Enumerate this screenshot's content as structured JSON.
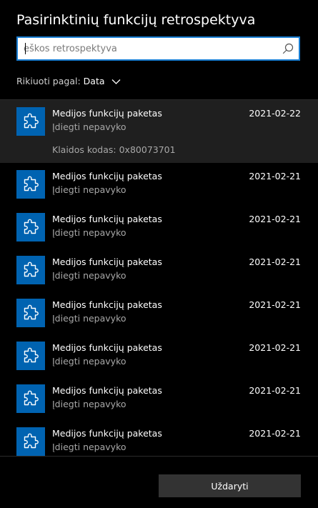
{
  "window": {
    "title": "Pasirinktinių funkcijų retrospektyva"
  },
  "search": {
    "placeholder": "eškos retrospektyva",
    "value": "",
    "icon": "search-icon"
  },
  "sort": {
    "label": "Rikiuoti pagal:",
    "value": "Data",
    "icon": "chevron-down-icon"
  },
  "items": [
    {
      "name": "Medijos funkcijų paketas",
      "status": "Įdiegti nepavyko",
      "date": "2021-02-22",
      "error": "Klaidos kodas: 0x80073701",
      "icon": "puzzle-icon",
      "selected": true
    },
    {
      "name": "Medijos funkcijų paketas",
      "status": "Įdiegti nepavyko",
      "date": "2021-02-21",
      "icon": "puzzle-icon"
    },
    {
      "name": "Medijos funkcijų paketas",
      "status": "Įdiegti nepavyko",
      "date": "2021-02-21",
      "icon": "puzzle-icon"
    },
    {
      "name": "Medijos funkcijų paketas",
      "status": "Įdiegti nepavyko",
      "date": "2021-02-21",
      "icon": "puzzle-icon"
    },
    {
      "name": "Medijos funkcijų paketas",
      "status": "Įdiegti nepavyko",
      "date": "2021-02-21",
      "icon": "puzzle-icon"
    },
    {
      "name": "Medijos funkcijų paketas",
      "status": "Įdiegti nepavyko",
      "date": "2021-02-21",
      "icon": "puzzle-icon"
    },
    {
      "name": "Medijos funkcijų paketas",
      "status": "Įdiegti nepavyko",
      "date": "2021-02-21",
      "icon": "puzzle-icon"
    },
    {
      "name": "Medijos funkcijų paketas",
      "status": "Įdiegti nepavyko",
      "date": "2021-02-21",
      "icon": "puzzle-icon"
    }
  ],
  "footer": {
    "close_label": "Uždaryti"
  },
  "colors": {
    "background": "#000000",
    "accent": "#0063b1",
    "focus_border": "#1a7fd4",
    "selected_row": "#1f1f1f",
    "button": "#333333",
    "secondary_text": "#a8a8a8"
  }
}
